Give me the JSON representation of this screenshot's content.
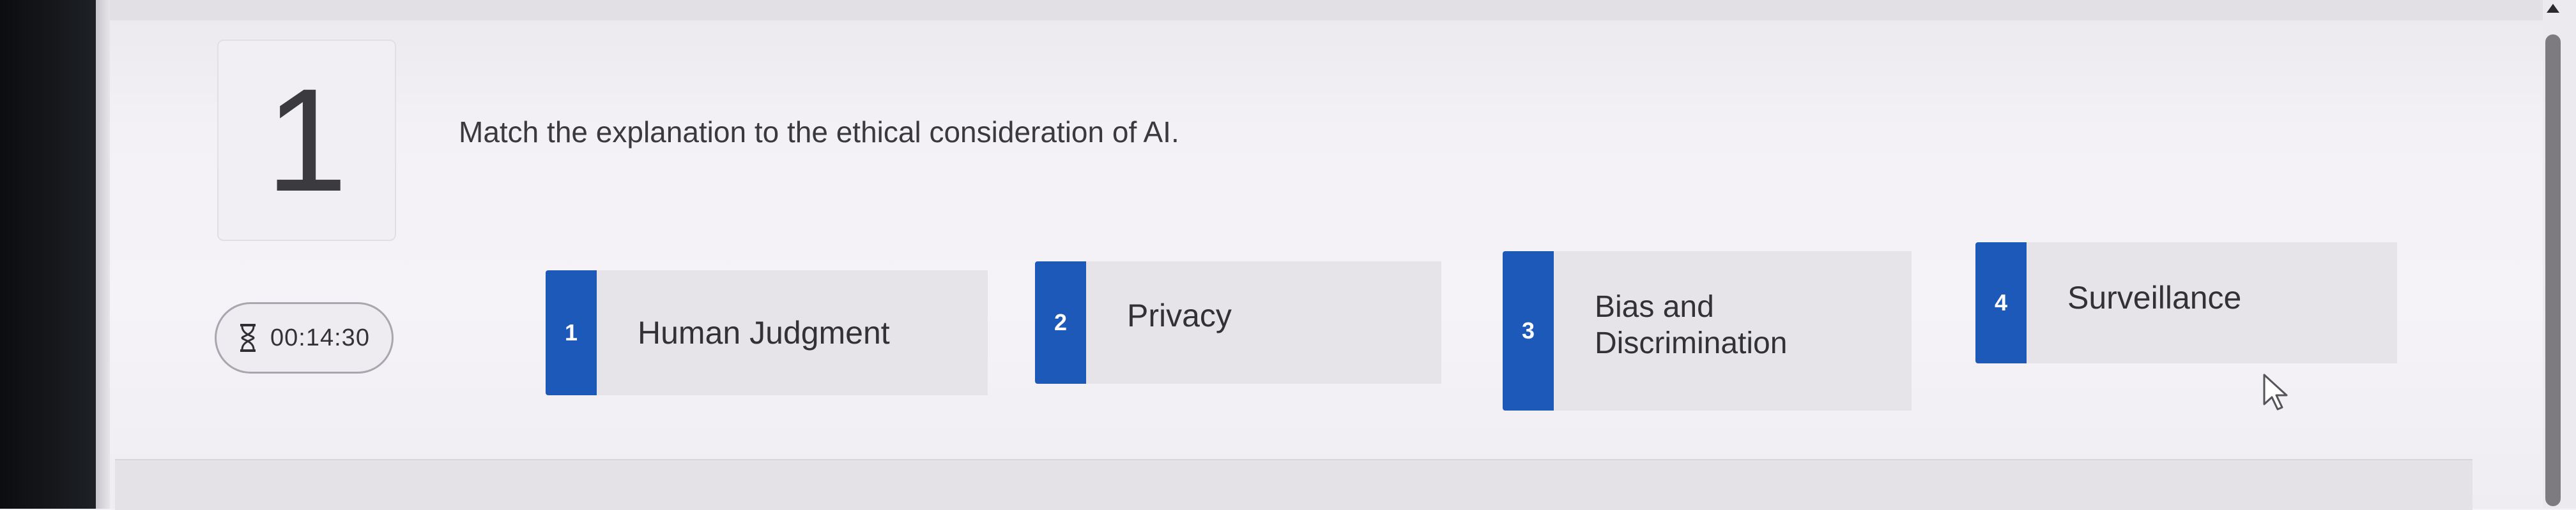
{
  "question": {
    "number": "1",
    "prompt": "Match the explanation to the ethical consideration of AI."
  },
  "timer": {
    "icon": "hourglass-icon",
    "time": "00:14:30"
  },
  "options": [
    {
      "badge": "1",
      "label": "Human Judgment"
    },
    {
      "badge": "2",
      "label": "Privacy"
    },
    {
      "badge": "3",
      "label_line1": "Bias and",
      "label_line2": "Discrimination"
    },
    {
      "badge": "4",
      "label": "Surveillance"
    }
  ],
  "colors": {
    "badge": "#1c59b8",
    "card": "#e6e4e9",
    "background": "#f4f2f6"
  }
}
